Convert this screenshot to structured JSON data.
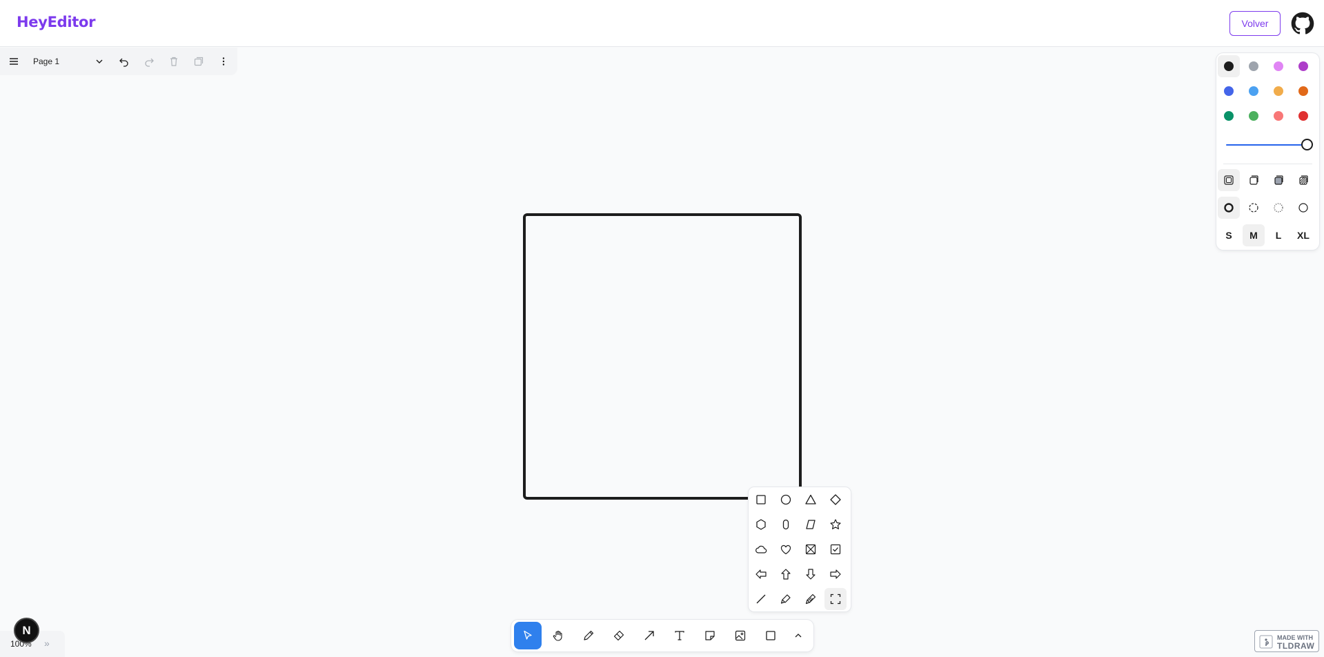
{
  "header": {
    "brand": "HeyEditor",
    "back_button": "Volver",
    "github_icon": "github-icon"
  },
  "page_menu": {
    "page_name": "Page 1",
    "icons": [
      "menu-icon",
      "chevron-down-icon",
      "undo-icon",
      "redo-icon",
      "trash-icon",
      "duplicate-icon",
      "more-icon"
    ]
  },
  "style_panel": {
    "colors": [
      {
        "name": "black",
        "hex": "#1d1d1d",
        "selected": true
      },
      {
        "name": "grey",
        "hex": "#9ea4ad"
      },
      {
        "name": "light-violet",
        "hex": "#e085f4"
      },
      {
        "name": "violet",
        "hex": "#ae3ec9"
      },
      {
        "name": "blue",
        "hex": "#4465e9"
      },
      {
        "name": "light-blue",
        "hex": "#4ba1f1"
      },
      {
        "name": "yellow",
        "hex": "#f1ac4b"
      },
      {
        "name": "orange",
        "hex": "#e16919"
      },
      {
        "name": "green",
        "hex": "#099268"
      },
      {
        "name": "light-green",
        "hex": "#4cb05e"
      },
      {
        "name": "light-red",
        "hex": "#f87777"
      },
      {
        "name": "red",
        "hex": "#e03131"
      }
    ],
    "opacity": 1.0,
    "fill_icons": [
      "fill-none-icon",
      "fill-semi-icon",
      "fill-solid-icon",
      "fill-pattern-icon"
    ],
    "dash_icons": [
      "dash-draw-icon",
      "dash-dashed-icon",
      "dash-dotted-icon",
      "dash-solid-icon"
    ],
    "sizes": [
      "S",
      "M",
      "L",
      "XL"
    ],
    "selected_size": "M"
  },
  "geo_picker": {
    "shapes": [
      "rectangle-icon",
      "ellipse-icon",
      "triangle-icon",
      "diamond-icon",
      "hexagon-icon",
      "oval-icon",
      "trapezoid-icon",
      "star-icon",
      "cloud-icon",
      "heart-icon",
      "x-box-icon",
      "check-box-icon",
      "arrow-left-icon",
      "arrow-up-icon",
      "arrow-down-icon",
      "arrow-right-icon",
      "line-icon",
      "highlighter-icon",
      "laser-icon",
      "frame-icon"
    ]
  },
  "toolbar": {
    "tools": [
      "select-icon",
      "hand-icon",
      "draw-icon",
      "eraser-icon",
      "arrow-icon",
      "text-icon",
      "note-icon",
      "image-icon",
      "rectangle-tool-icon",
      "chevron-up-icon"
    ],
    "selected": "select-icon"
  },
  "zoom": {
    "label": "100%",
    "expand": "»"
  },
  "badge": {
    "letter": "N"
  },
  "watermark": {
    "line1": "MADE WITH",
    "line2": "TLDRAW"
  },
  "colors": {
    "brand": "#7c3aed",
    "accent": "#2f80ed",
    "stroke": "#1d1d1d"
  }
}
